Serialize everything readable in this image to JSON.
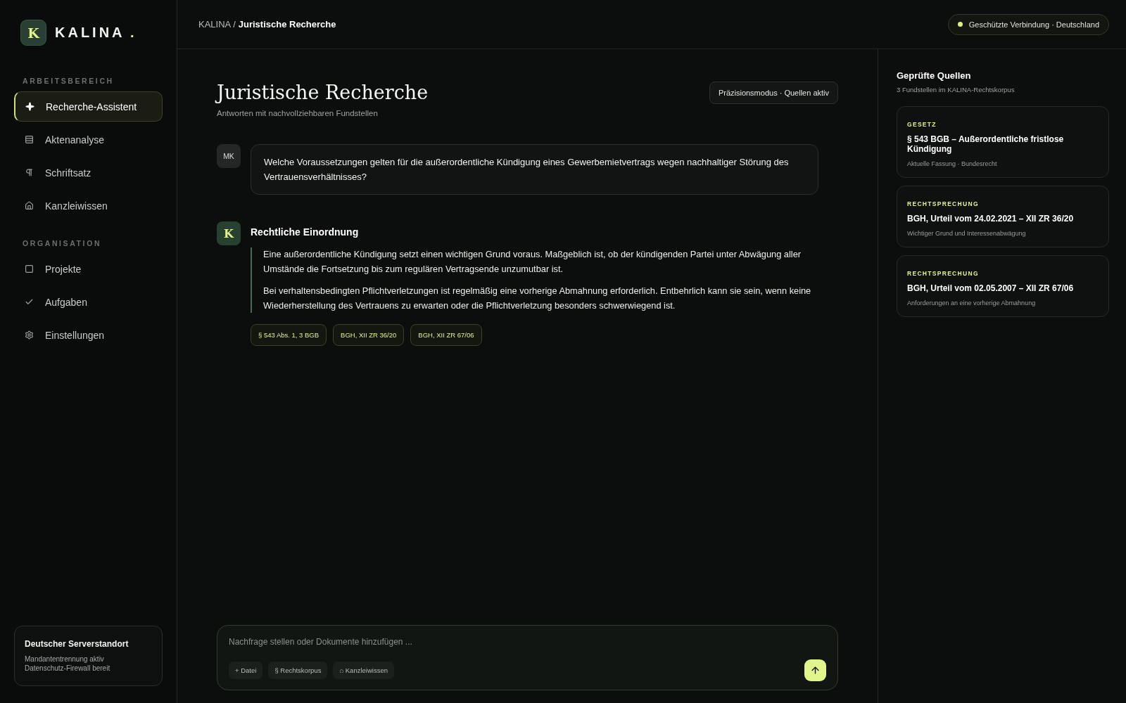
{
  "brand": {
    "mark": "K",
    "name": "KALINA",
    "dot": "."
  },
  "sidebar": {
    "sections": [
      {
        "heading": "ARBEITSBEREICH",
        "items": [
          {
            "label": "Recherche-Assistent",
            "selected": true
          },
          {
            "label": "Aktenanalyse",
            "selected": false
          },
          {
            "label": "Schriftsatz",
            "selected": false
          },
          {
            "label": "Kanzleiwissen",
            "selected": false
          }
        ]
      },
      {
        "heading": "ORGANISATION",
        "items": [
          {
            "label": "Projekte",
            "selected": false
          },
          {
            "label": "Aufgaben",
            "selected": false
          },
          {
            "label": "Einstellungen",
            "selected": false
          }
        ]
      }
    ],
    "footer_card": {
      "title": "Deutscher Serverstandort",
      "lines": [
        "Mandantentrennung aktiv",
        "Datenschutz-Firewall bereit"
      ]
    }
  },
  "header": {
    "breadcrumb": {
      "parent": "KALINA /",
      "current": "Juristische Recherche"
    },
    "status": {
      "label": "Geschützte Verbindung · Deutschland",
      "color": "#d9f27a"
    }
  },
  "main": {
    "title": "Juristische Recherche",
    "subtitle": "Antworten mit nachvollziehbaren Fundstellen",
    "mode_badge": "Präzisionsmodus · Quellen aktiv",
    "messages": [
      {
        "kind": "user",
        "avatar": "MK",
        "text": "Welche Voraussetzungen gelten für die außerordentliche Kündigung eines Gewerbemietvertrags wegen nachhaltiger Störung des Vertrauensverhältnisses?"
      },
      {
        "kind": "assistant",
        "avatar": "K",
        "title": "Rechtliche Einordnung",
        "paragraphs": [
          "Eine außerordentliche Kündigung setzt einen wichtigen Grund voraus. Maßgeblich ist, ob der kündigenden Partei unter Abwägung aller Umstände die Fortsetzung bis zum regulären Vertragsende unzumutbar ist.",
          "Bei verhaltensbedingten Pflichtverletzungen ist regelmäßig eine vorherige Abmahnung erforderlich. Entbehrlich kann sie sein, wenn keine Wiederherstellung des Vertrauens zu erwarten oder die Pflichtverletzung besonders schwerwiegend ist."
        ],
        "citations": [
          "§ 543 Abs. 1, 3 BGB",
          "BGH, XII ZR 36/20",
          "BGH, XII ZR 67/06"
        ]
      }
    ],
    "composer": {
      "placeholder": "Nachfrage stellen oder Dokumente hinzufügen ...",
      "tools": [
        "+ Datei",
        "§ Rechtskorpus",
        "⌂ Kanzleiwissen"
      ]
    }
  },
  "sources_panel": {
    "title": "Geprüfte Quellen",
    "subtitle": "3 Fundstellen im KALINA-Rechtskorpus",
    "sources": [
      {
        "category": "GESETZ",
        "title": "§ 543 BGB – Außerordentliche fristlose Kündigung",
        "meta": "Aktuelle Fassung · Bundesrecht"
      },
      {
        "category": "RECHTSPRECHUNG",
        "title": "BGH, Urteil vom 24.02.2021 – XII ZR 36/20",
        "meta": "Wichtiger Grund und Interessenabwägung"
      },
      {
        "category": "RECHTSPRECHUNG",
        "title": "BGH, Urteil vom 02.05.2007 – XII ZR 67/06",
        "meta": "Anforderungen an eine vorherige Abmahnung"
      }
    ]
  }
}
